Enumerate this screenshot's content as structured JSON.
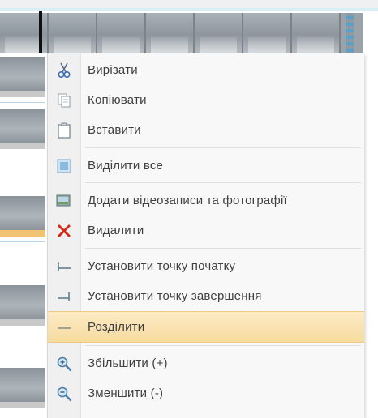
{
  "context_menu": {
    "items": [
      {
        "label": "Вирізати",
        "icon": "scissors-icon"
      },
      {
        "label": "Копіювати",
        "icon": "copy-icon"
      },
      {
        "label": "Вставити",
        "icon": "paste-icon"
      },
      {
        "label": "Виділити все",
        "icon": "select-all-icon"
      },
      {
        "label": "Додати відеозаписи та фотографії",
        "icon": "add-media-icon"
      },
      {
        "label": "Видалити",
        "icon": "delete-icon"
      },
      {
        "label": "Установити точку початку",
        "icon": "set-start-point-icon"
      },
      {
        "label": "Установити точку завершення",
        "icon": "set-end-point-icon"
      },
      {
        "label": "Розділити",
        "icon": "split-icon",
        "highlighted": true
      },
      {
        "label": "Збільшити (+)",
        "icon": "zoom-in-icon"
      },
      {
        "label": "Зменшити (-)",
        "icon": "zoom-out-icon"
      }
    ]
  },
  "colors": {
    "highlight": "#f7dba0",
    "delete_icon": "#d42a1a",
    "accent_blue": "#5d9fc7"
  }
}
